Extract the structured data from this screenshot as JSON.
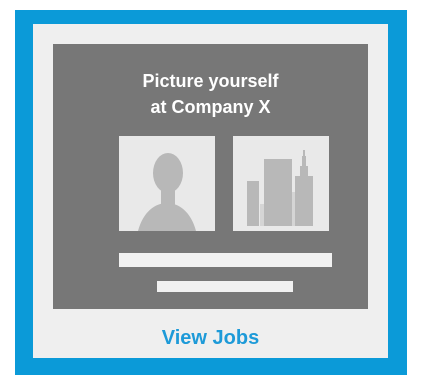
{
  "promo": {
    "headline_line_1": "Picture yourself",
    "headline_line_2": "at Company X",
    "image_person_icon": "person-placeholder-icon",
    "image_building_icon": "building-placeholder-icon",
    "button_label": "View Jobs"
  },
  "colors": {
    "frame_blue": "#0b9ad8",
    "card_background": "#efefef",
    "panel_gray": "#777777",
    "tile_gray": "#e9e9e9",
    "icon_gray": "#b8b8b8",
    "link_blue": "#1d9ad8",
    "headline_white": "#ffffff"
  }
}
